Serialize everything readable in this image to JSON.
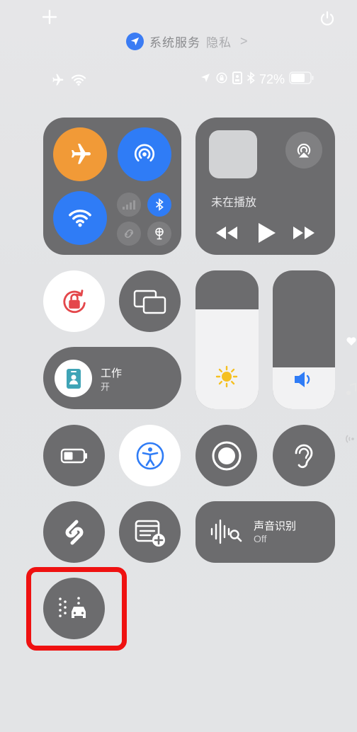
{
  "top_bar": {
    "add_icon": "plus-icon",
    "power_icon": "power-icon"
  },
  "location_banner": {
    "service": "系统服务",
    "privacy": "隐私",
    "chevron": ">"
  },
  "status_bar": {
    "battery_percent": "72%",
    "icons_left": [
      "airplane-icon",
      "wifi-icon"
    ],
    "icons_right": [
      "location-icon",
      "rotation-lock-icon",
      "focus-badge-icon",
      "bluetooth-icon",
      "battery-icon"
    ]
  },
  "connectivity": {
    "airplane": "on",
    "airdrop": "on",
    "wifi": "on",
    "cellular": "off",
    "bluetooth": "on",
    "hotspot": "off",
    "vpn": "off"
  },
  "now_playing": {
    "label": "未在播放"
  },
  "focus": {
    "title": "工作",
    "status": "开"
  },
  "sliders": {
    "brightness_level": 0.72,
    "volume_level": 0.3
  },
  "sound_recognition": {
    "title": "声音识别",
    "status": "Off"
  },
  "colors": {
    "tile": "#6c6c6e",
    "airplane": "#f19a37",
    "blue": "#2f7cf6",
    "highlight": "#ef1111"
  }
}
